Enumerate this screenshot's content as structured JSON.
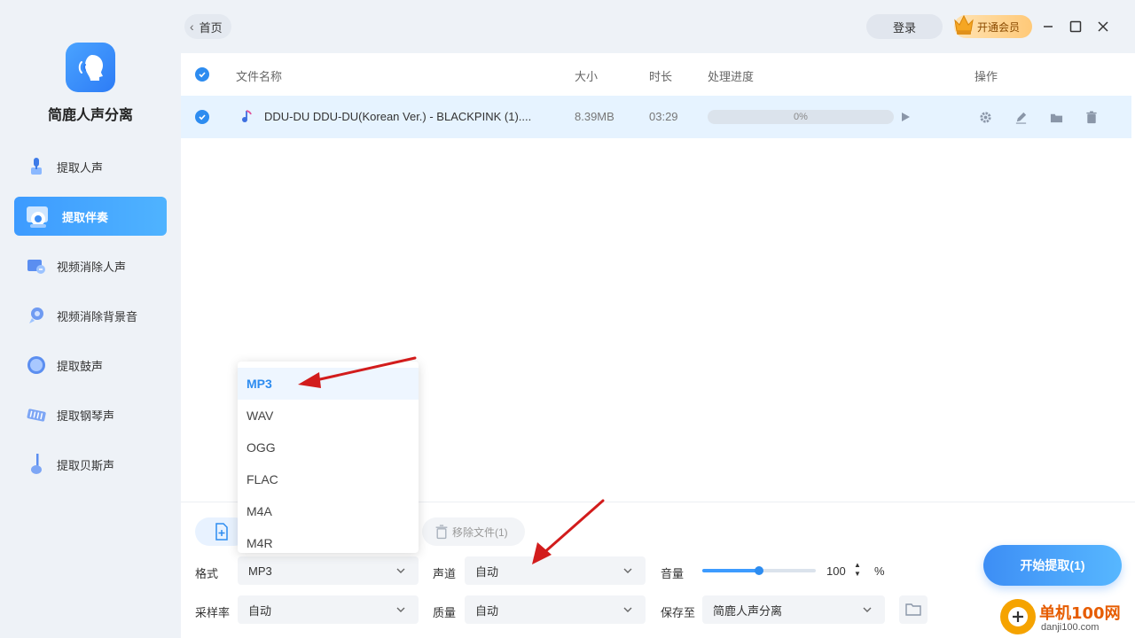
{
  "app": {
    "name": "简鹿人声分离"
  },
  "topbar": {
    "back_label": "首页",
    "login_label": "登录",
    "vip_label": "开通会员"
  },
  "sidebar": {
    "items": [
      {
        "label": "提取人声",
        "icon": "vocal-icon",
        "active": false
      },
      {
        "label": "提取伴奏",
        "icon": "accompaniment-icon",
        "active": true
      },
      {
        "label": "视频消除人声",
        "icon": "video-vocal-remove-icon",
        "active": false
      },
      {
        "label": "视频消除背景音",
        "icon": "video-bg-remove-icon",
        "active": false
      },
      {
        "label": "提取鼓声",
        "icon": "drum-icon",
        "active": false
      },
      {
        "label": "提取钢琴声",
        "icon": "piano-icon",
        "active": false
      },
      {
        "label": "提取贝斯声",
        "icon": "bass-icon",
        "active": false
      }
    ]
  },
  "table": {
    "headers": {
      "name": "文件名称",
      "size": "大小",
      "duration": "时长",
      "progress": "处理进度",
      "ops": "操作"
    },
    "rows": [
      {
        "name": "DDU-DU DDU-DU(Korean Ver.) - BLACKPINK (1)....",
        "size": "8.39MB",
        "duration": "03:29",
        "progress_text": "0%",
        "progress": 0
      }
    ]
  },
  "actions": {
    "remove_label": "移除文件(1)",
    "start_label": "开始提取(1)"
  },
  "settings": {
    "format_label": "格式",
    "format_value": "MP3",
    "channel_label": "声道",
    "channel_value": "自动",
    "volume_label": "音量",
    "volume_value": "100",
    "volume_unit": "%",
    "volume_level": 0.5,
    "samplerate_label": "采样率",
    "samplerate_value": "自动",
    "quality_label": "质量",
    "quality_value": "自动",
    "saveto_label": "保存至",
    "saveto_value": "简鹿人声分离"
  },
  "format_dropdown": {
    "options": [
      "MP3",
      "WAV",
      "OGG",
      "FLAC",
      "M4A",
      "M4R"
    ],
    "selected": "MP3"
  },
  "watermark": {
    "text": "单机100网",
    "url": "danji100.com"
  },
  "colors": {
    "accent": "#2d8cf0",
    "row_highlight": "#e6f3ff",
    "annotation_arrow": "#e02020"
  }
}
